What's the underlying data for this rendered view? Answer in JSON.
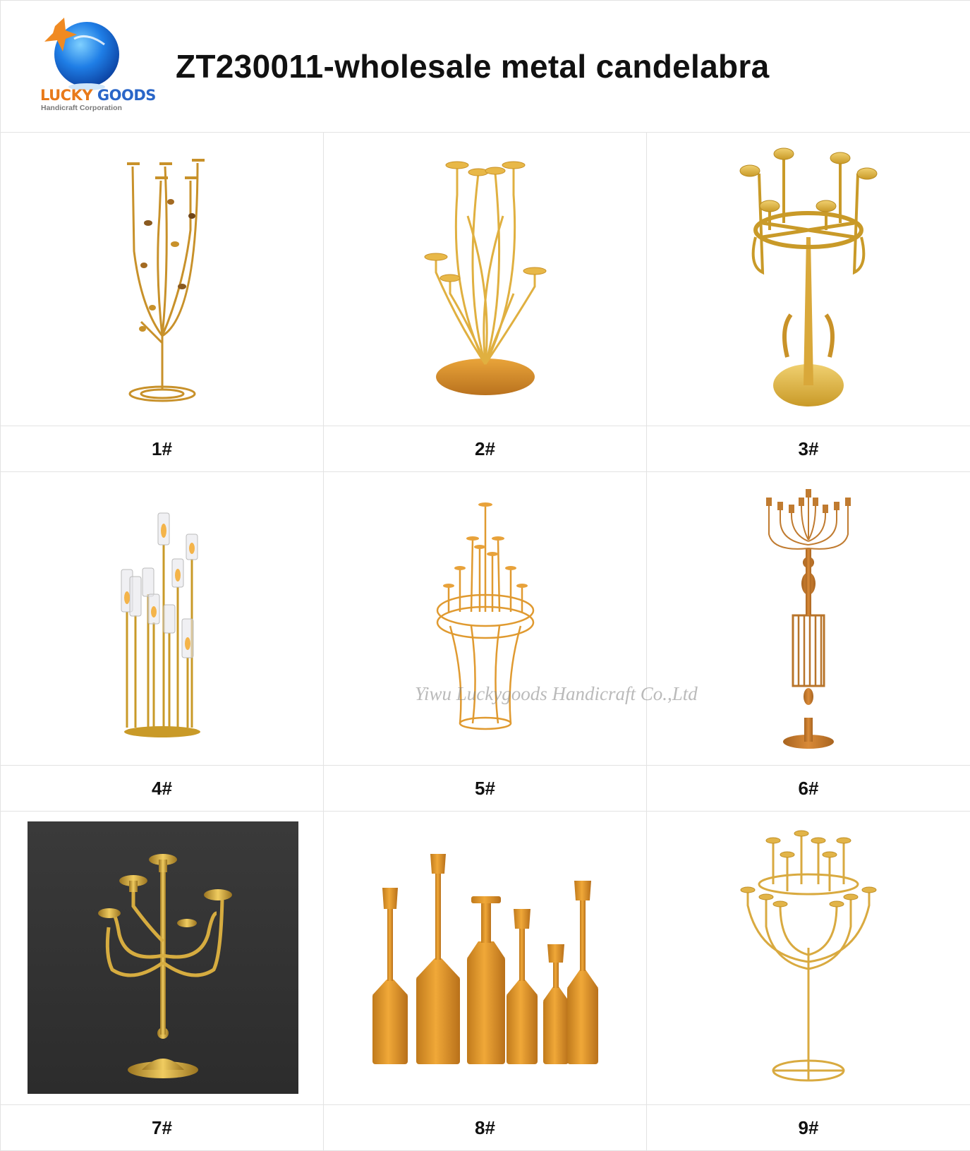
{
  "header": {
    "title": "ZT230011-wholesale metal candelabra",
    "logo": {
      "brand_line1": "LUCKY",
      "brand_line2": "GOODS",
      "tagline": "Handicraft Corporation"
    }
  },
  "products": [
    {
      "label": "1#",
      "icon": "tree-candelabra-icon"
    },
    {
      "label": "2#",
      "icon": "bamboo-candelabra-icon"
    },
    {
      "label": "3#",
      "icon": "ring-candelabra-icon"
    },
    {
      "label": "4#",
      "icon": "glass-tube-candelabra-icon"
    },
    {
      "label": "5#",
      "icon": "wire-tier-candelabra-icon"
    },
    {
      "label": "6#",
      "icon": "tall-column-candelabra-icon"
    },
    {
      "label": "7#",
      "icon": "classic-arm-candelabra-icon"
    },
    {
      "label": "8#",
      "icon": "bottle-candlestick-set-icon"
    },
    {
      "label": "9#",
      "icon": "cup-ring-candelabra-icon"
    }
  ],
  "watermark": "Yiwu Luckygoods Handicraft Co.,Ltd",
  "colors": {
    "gold": "#d9a83a",
    "copper": "#c8822e",
    "border": "#e3e3e3"
  }
}
